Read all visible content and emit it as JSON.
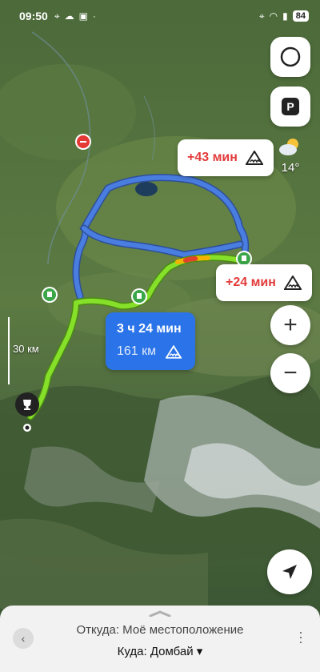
{
  "status_bar": {
    "time": "09:50",
    "battery": "84"
  },
  "map": {
    "scale_label": "30 км",
    "weather": {
      "icon": "partly-cloudy-icon",
      "temperature": "14°"
    }
  },
  "route_alternatives": [
    {
      "delta": "+43 мин",
      "icon": "bumpy-road-icon"
    },
    {
      "delta": "+24 мин",
      "icon": "bumpy-road-icon"
    }
  ],
  "selected_route": {
    "duration": "3 ч 24 мин",
    "distance": "161 км",
    "icon": "bumpy-road-icon"
  },
  "controls": {
    "parking_label": "P",
    "zoom_in": "+",
    "zoom_out": "−"
  },
  "bottom_panel": {
    "from_text": "Откуда: Моё местоположение",
    "to_text": "Куда: Домбай ▾"
  },
  "colors": {
    "route_selected": "#7ed321",
    "route_alternative": "#3f6fd8",
    "route_bubble": "#2a73e8",
    "delay_text": "#e33a3a"
  }
}
